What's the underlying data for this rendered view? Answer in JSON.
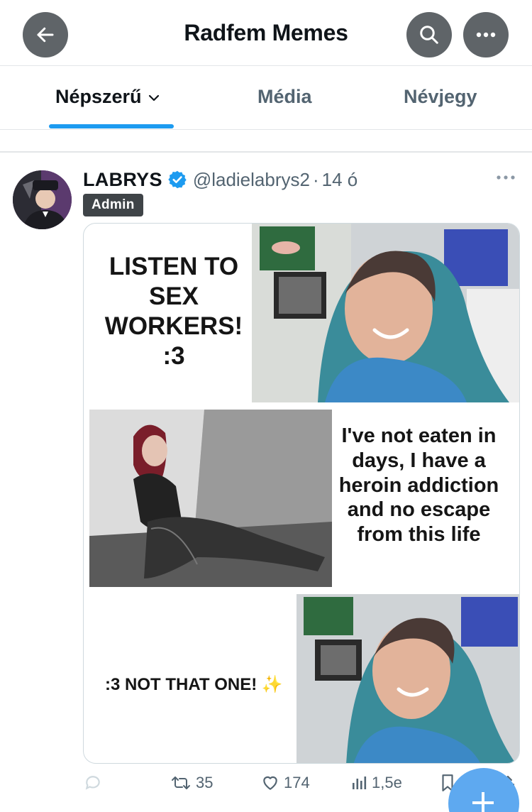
{
  "header": {
    "title": "Radfem Memes",
    "back_icon": "arrow-left-icon",
    "search_icon": "search-icon",
    "more_icon": "more-horizontal-icon"
  },
  "tabs": [
    {
      "label": "Népszerű",
      "active": true
    },
    {
      "label": "Média",
      "active": false
    },
    {
      "label": "Névjegy",
      "active": false
    }
  ],
  "post": {
    "display_name": "LABRYS",
    "verified": true,
    "handle": "@ladielabrys2",
    "separator": "·",
    "time": "14 ó",
    "badge": "Admin",
    "image": {
      "panel1_text": "LISTEN TO SEX WORKERS! :3",
      "panel2_text": "I've not eaten in days, I have a heroin addiction and no escape from this life",
      "panel3_text": ":3 NOT THAT ONE! ✨"
    },
    "actions": {
      "reply_count": "",
      "repost_count": "35",
      "like_count": "174",
      "views_count": "1,5e"
    }
  },
  "colors": {
    "accent": "#1d9bf0",
    "muted_text": "#536471",
    "header_button_bg": "#5f6468",
    "badge_bg": "#3f4448",
    "fab_bg": "#5ea9f0"
  }
}
